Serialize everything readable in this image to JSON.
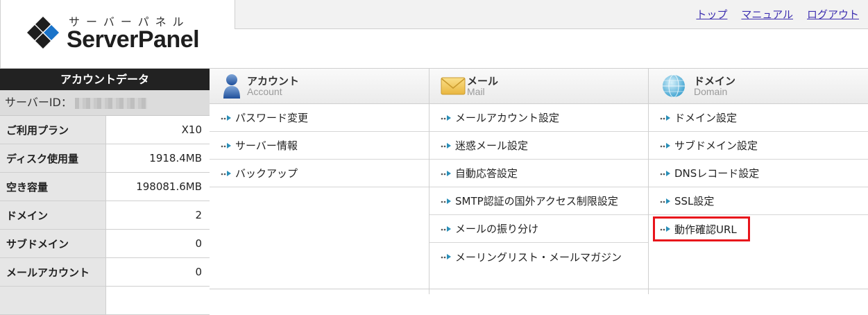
{
  "logo": {
    "kana": "サーバーパネル",
    "brand": "ServerPanel"
  },
  "toplinks": [
    {
      "label": "トップ"
    },
    {
      "label": "マニュアル"
    },
    {
      "label": "ログアウト"
    }
  ],
  "account": {
    "title": "アカウントデータ",
    "server_id_label": "サーバーID：",
    "rows": [
      {
        "label": "ご利用プラン",
        "value": "X10"
      },
      {
        "label": "ディスク使用量",
        "value": "1918.4MB"
      },
      {
        "label": "空き容量",
        "value": "198081.6MB"
      },
      {
        "label": "ドメイン",
        "value": "2"
      },
      {
        "label": "サブドメイン",
        "value": "0"
      },
      {
        "label": "メールアカウント",
        "value": "0"
      }
    ]
  },
  "columns": [
    {
      "title": "アカウント",
      "subtitle": "Account",
      "icon": "account-icon",
      "items": [
        {
          "label": "パスワード変更"
        },
        {
          "label": "サーバー情報"
        },
        {
          "label": "バックアップ"
        }
      ]
    },
    {
      "title": "メール",
      "subtitle": "Mail",
      "icon": "mail-icon",
      "items": [
        {
          "label": "メールアカウント設定"
        },
        {
          "label": "迷惑メール設定"
        },
        {
          "label": "自動応答設定"
        },
        {
          "label": "SMTP認証の国外アクセス制限設定"
        },
        {
          "label": "メールの振り分け"
        },
        {
          "label": "メーリングリスト・メールマガジン"
        }
      ]
    },
    {
      "title": "ドメイン",
      "subtitle": "Domain",
      "icon": "globe-icon",
      "items": [
        {
          "label": "ドメイン設定"
        },
        {
          "label": "サブドメイン設定"
        },
        {
          "label": "DNSレコード設定"
        },
        {
          "label": "SSL設定"
        },
        {
          "label": "動作確認URL"
        }
      ]
    }
  ],
  "colors": {
    "highlight": "#e8141b",
    "link": "#3d2fb0",
    "logo_blue": "#1a73c9"
  }
}
